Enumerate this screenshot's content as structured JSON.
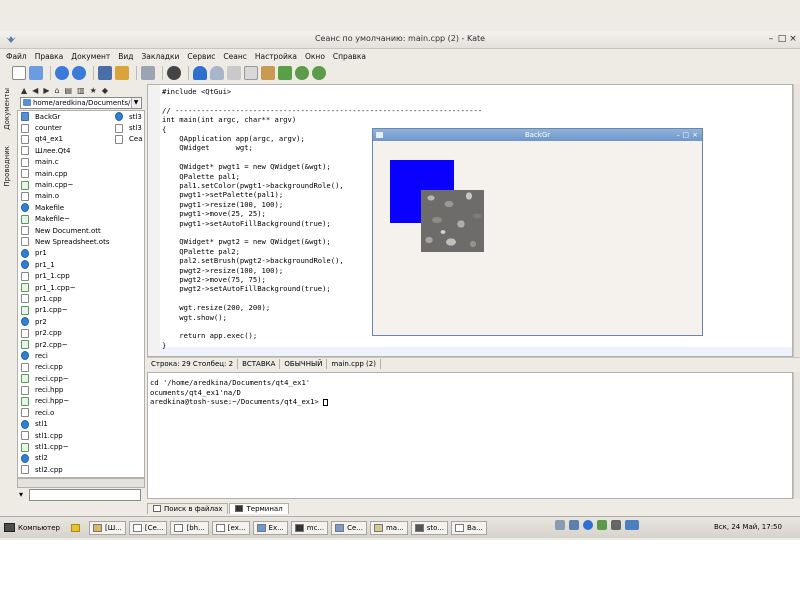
{
  "window": {
    "title": "Сеанс по умолчанию: main.cpp (2) - Kate",
    "minimize": "–",
    "maximize": "□",
    "close": "×"
  },
  "menu": [
    "Файл",
    "Правка",
    "Документ",
    "Вид",
    "Закладки",
    "Сервис",
    "Сеанс",
    "Настройка",
    "Окно",
    "Справка"
  ],
  "toolbar_icons": [
    "new-document-icon",
    "open-icon",
    "back-icon",
    "forward-icon",
    "save-icon",
    "save-as-icon",
    "print-icon",
    "close-document-icon",
    "undo-icon",
    "redo-icon",
    "cut-icon",
    "copy-icon",
    "paste-icon",
    "find-icon",
    "zoom-in-icon",
    "zoom-out-icon"
  ],
  "side_tabs": {
    "documents": "Документы",
    "file_browser": "Проводник"
  },
  "file_browser": {
    "path": "home/aredkina/Documents/",
    "files": [
      {
        "name": "BackGr",
        "icon": "folder"
      },
      {
        "name": "counter",
        "icon": "doc"
      },
      {
        "name": "qt4_ex1",
        "icon": "doc"
      },
      {
        "name": "Шлее.Qt4",
        "icon": "doc"
      },
      {
        "name": "main.c",
        "icon": "doc"
      },
      {
        "name": "main.cpp",
        "icon": "doc"
      },
      {
        "name": "main.cpp~",
        "icon": "green"
      },
      {
        "name": "main.o",
        "icon": "doc"
      },
      {
        "name": "Makefile",
        "icon": "blue"
      },
      {
        "name": "Makefile~",
        "icon": "green"
      },
      {
        "name": "New Document.ott",
        "icon": "doc"
      },
      {
        "name": "New Spreadsheet.ots",
        "icon": "doc"
      },
      {
        "name": "pr1",
        "icon": "blue"
      },
      {
        "name": "pr1_1",
        "icon": "blue"
      },
      {
        "name": "pr1_1.cpp",
        "icon": "doc"
      },
      {
        "name": "pr1_1.cpp~",
        "icon": "green"
      },
      {
        "name": "pr1.cpp",
        "icon": "doc"
      },
      {
        "name": "pr1.cpp~",
        "icon": "green"
      },
      {
        "name": "pr2",
        "icon": "blue"
      },
      {
        "name": "pr2.cpp",
        "icon": "doc"
      },
      {
        "name": "pr2.cpp~",
        "icon": "green"
      },
      {
        "name": "reci",
        "icon": "blue"
      },
      {
        "name": "reci.cpp",
        "icon": "doc"
      },
      {
        "name": "reci.cpp~",
        "icon": "green"
      },
      {
        "name": "reci.hpp",
        "icon": "doc"
      },
      {
        "name": "reci.hpp~",
        "icon": "green"
      },
      {
        "name": "reci.o",
        "icon": "doc"
      },
      {
        "name": "stl1",
        "icon": "blue"
      },
      {
        "name": "stl1.cpp",
        "icon": "doc"
      },
      {
        "name": "stl1.cpp~",
        "icon": "green"
      },
      {
        "name": "stl2",
        "icon": "blue"
      },
      {
        "name": "stl2.cpp",
        "icon": "doc"
      },
      {
        "name": "stl2.cpp~",
        "icon": "green"
      }
    ],
    "files_col2": [
      {
        "name": "stl3",
        "icon": "blue"
      },
      {
        "name": "stl3",
        "icon": "doc"
      },
      {
        "name": "Сеа",
        "icon": "doc"
      }
    ]
  },
  "editor": {
    "lines": [
      "#include <QtGui>",
      "",
      "// -----------------------------------------------------------------------",
      "int main(int argc, char** argv)",
      "{",
      "    QApplication app(argc, argv);",
      "    QWidget      wgt;",
      "",
      "    QWidget* pwgt1 = new QWidget(&wgt);",
      "    QPalette pal1;",
      "    pal1.setColor(pwgt1->backgroundRole(),",
      "    pwgt1->setPalette(pal1);",
      "    pwgt1->resize(100, 100);",
      "    pwgt1->move(25, 25);",
      "    pwgt1->setAutoFillBackground(true);",
      "",
      "    QWidget* pwgt2 = new QWidget(&wgt);",
      "    QPalette pal2;",
      "    pal2.setBrush(pwgt2->backgroundRole(),",
      "    pwgt2->resize(100, 100);",
      "    pwgt2->move(75, 75);",
      "    pwgt2->setAutoFillBackground(true);",
      "",
      "    wgt.resize(200, 200);",
      "    wgt.show();",
      "",
      "    return app.exec();",
      "}"
    ]
  },
  "statusbar": {
    "position": "Строка: 29 Столбец: 2",
    "mode": "ВСТАВКА",
    "normal": "ОБЫЧНЫЙ",
    "file": "main.cpp (2)"
  },
  "backgr_window": {
    "title": "BackGr",
    "minimize": "–",
    "maximize": "□",
    "close": "×",
    "blue_color": "#0a00ff"
  },
  "terminal": {
    "lines": [
      "cd '/home/aredkina/Documents/qt4_ex1'",
      "ocuments/qt4_ex1'na/D",
      "aredkina@tosh-suse:~/Documents/qt4_ex1> "
    ]
  },
  "bottom_tabs": [
    "Поиск в файлах",
    "Терминал"
  ],
  "taskbar": {
    "start": "Компьютер",
    "tasks": [
      "[Ш...",
      "[Се...",
      "[bh...",
      "[ex...",
      "Ex...",
      "mc...",
      "Се...",
      "ma...",
      "sto...",
      "Ba..."
    ],
    "clock": "Вск, 24 Май, 17:50"
  },
  "colors": {
    "accent": "#6f97c7",
    "window_bg": "#eeeae4"
  }
}
